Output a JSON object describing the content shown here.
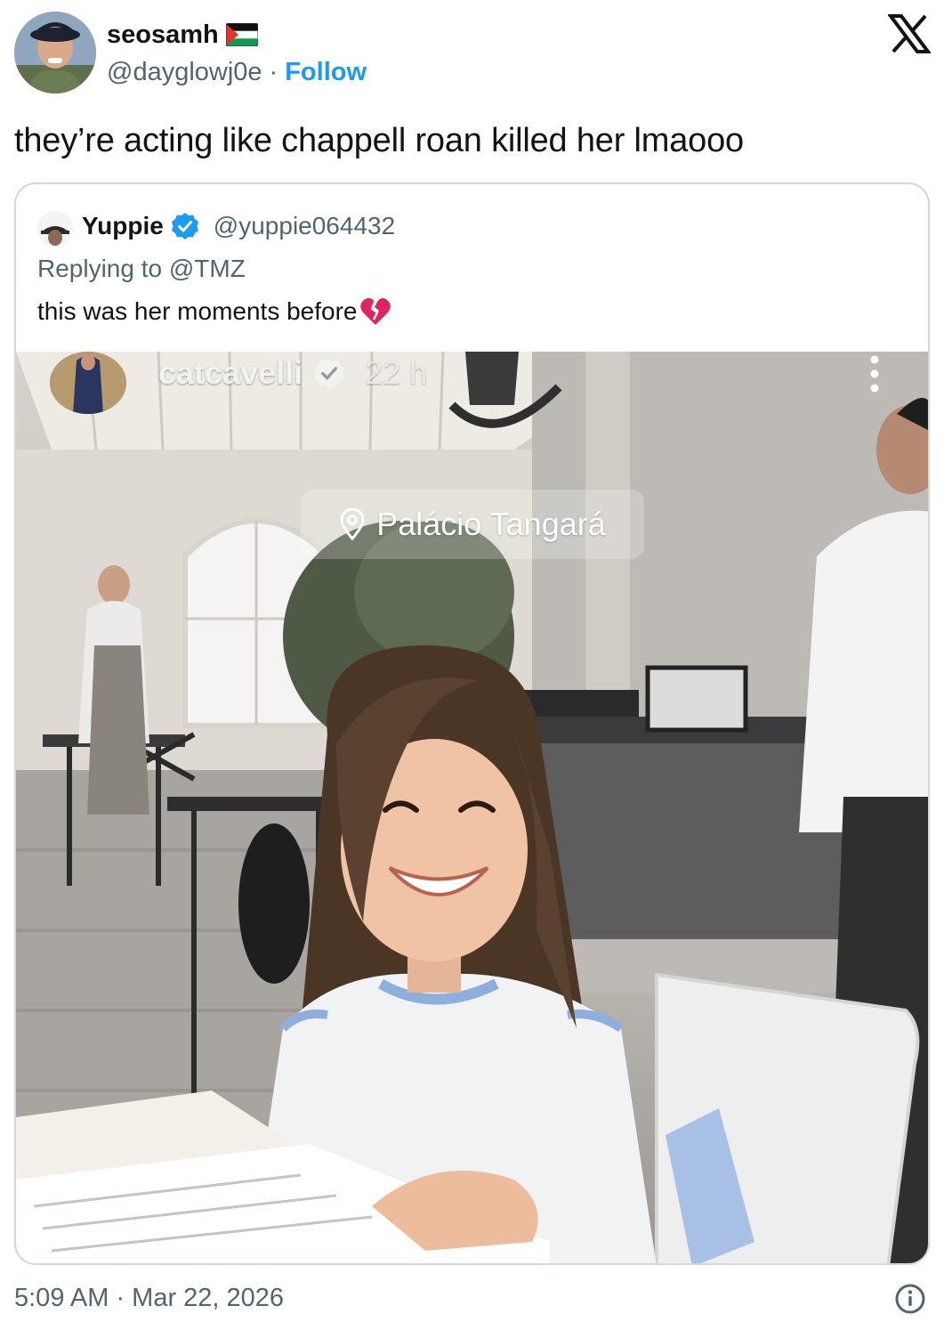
{
  "author": {
    "name": "seosamh",
    "flag_icon": "palestine-flag-icon",
    "handle": "@dayglowj0e",
    "separator": "·",
    "follow_label": "Follow"
  },
  "brand_icon": "x-logo-icon",
  "tweet": {
    "text": "they’re acting like chappell roan killed her lmaooo"
  },
  "quote": {
    "name": "Yuppie",
    "verified_icon": "verified-badge-icon",
    "handle": "@yuppie064432",
    "replying_to": "Replying to @TMZ",
    "text": "this was her moments before",
    "emoji_icon": "broken-heart-icon",
    "media": {
      "story_user": "catcavelli",
      "story_time": "22 h",
      "location": "Palácio Tangará",
      "description_icon": "photo-restaurant-girl-smiling"
    }
  },
  "footer": {
    "timestamp": "5:09 AM · Mar 22, 2026",
    "info_icon": "info-icon"
  },
  "colors": {
    "text_primary": "#0f1419",
    "text_secondary": "#536471",
    "accent": "#1d9bf0",
    "border": "#cfd9de"
  }
}
